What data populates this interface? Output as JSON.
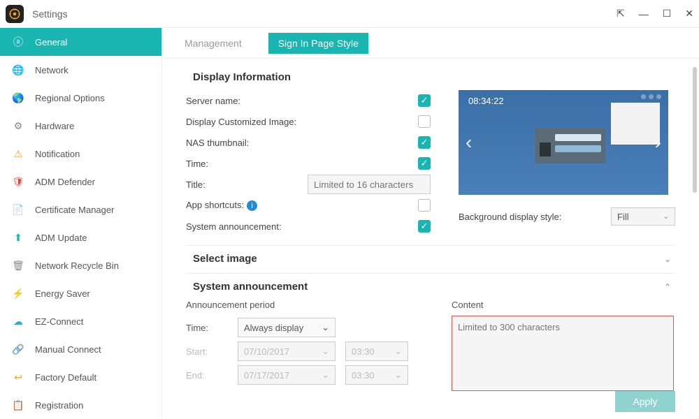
{
  "window": {
    "title": "Settings"
  },
  "sidebar": {
    "items": [
      {
        "label": "General",
        "active": true
      },
      {
        "label": "Network"
      },
      {
        "label": "Regional Options"
      },
      {
        "label": "Hardware"
      },
      {
        "label": "Notification"
      },
      {
        "label": "ADM Defender"
      },
      {
        "label": "Certificate Manager"
      },
      {
        "label": "ADM Update"
      },
      {
        "label": "Network Recycle Bin"
      },
      {
        "label": "Energy Saver"
      },
      {
        "label": "EZ-Connect"
      },
      {
        "label": "Manual Connect"
      },
      {
        "label": "Factory Default"
      },
      {
        "label": "Registration"
      }
    ]
  },
  "tabs": {
    "management": "Management",
    "signin": "Sign In Page Style"
  },
  "sections": {
    "display_info": "Display Information",
    "select_image": "Select image",
    "sys_ann": "System announcement"
  },
  "display": {
    "server_name": "Server name:",
    "custom_img": "Display Customized Image:",
    "nas_thumb": "NAS thumbnail:",
    "time": "Time:",
    "title": "Title:",
    "title_placeholder": "Limited to 16 characters",
    "app_shortcuts": "App shortcuts:",
    "sys_ann": "System announcement:",
    "checks": {
      "server_name": true,
      "custom_img": false,
      "nas_thumb": true,
      "time": true,
      "app_shortcuts": false,
      "sys_ann": true
    }
  },
  "preview": {
    "time": "08:34:22",
    "bg_label": "Background display style:",
    "bg_value": "Fill"
  },
  "ann": {
    "period_label": "Announcement period",
    "content_label": "Content",
    "time_label": "Time:",
    "time_value": "Always display",
    "start_label": "Start:",
    "end_label": "End:",
    "start_date": "07/10/2017",
    "start_time": "03:30",
    "end_date": "07/17/2017",
    "end_time": "03:30",
    "content_placeholder": "Limited to 300 characters"
  },
  "buttons": {
    "apply": "Apply"
  }
}
